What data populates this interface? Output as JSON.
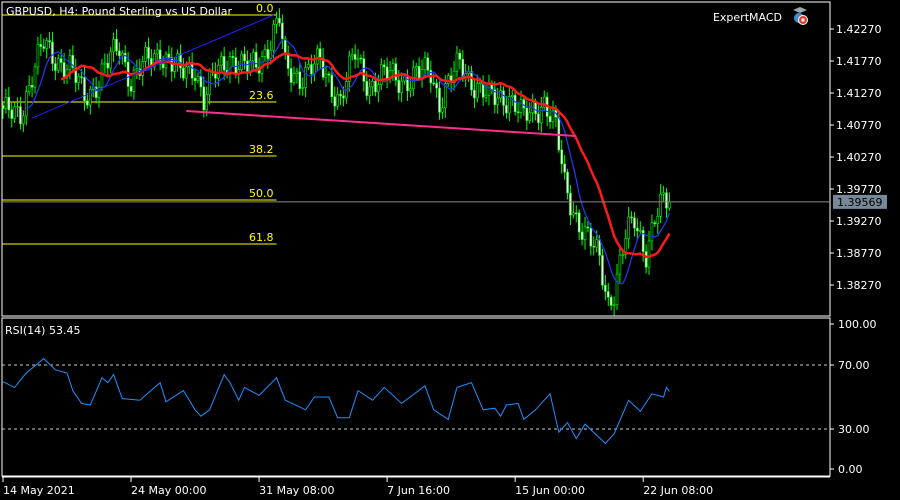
{
  "chart_data": {
    "type": "candlestick",
    "title": "GBPUSD, H4:  Pound Sterling vs US Dollar",
    "expert_label": "ExpertMACD",
    "current_price": 1.39569,
    "current_price_label": "1.39569",
    "y_ticks": [
      "1.42270",
      "1.41770",
      "1.41270",
      "1.40770",
      "1.40270",
      "1.39770",
      "1.39270",
      "1.38770",
      "1.38270"
    ],
    "y_tick_values": [
      1.4227,
      1.4177,
      1.4127,
      1.4077,
      1.4027,
      1.3977,
      1.3927,
      1.3877,
      1.3827
    ],
    "x_ticks": [
      {
        "label": "14 May 2021",
        "bar": 0
      },
      {
        "label": "24 May 00:00",
        "bar": 44
      },
      {
        "label": "31 May 08:00",
        "bar": 88
      },
      {
        "label": "7 Jun 16:00",
        "bar": 132
      },
      {
        "label": "15 Jun 00:00",
        "bar": 176
      },
      {
        "label": "22 Jun 08:00",
        "bar": 220
      }
    ],
    "bar_count": 230,
    "close_path": [
      [
        1,
        1.40926
      ],
      [
        6,
        1.41004
      ],
      [
        14,
        1.4202
      ],
      [
        23,
        1.4163
      ],
      [
        28,
        1.41239
      ],
      [
        33,
        1.41473
      ],
      [
        40,
        1.4202
      ],
      [
        44,
        1.41473
      ],
      [
        54,
        1.41942
      ],
      [
        61,
        1.41551
      ],
      [
        66,
        1.41707
      ],
      [
        69,
        1.41161
      ],
      [
        73,
        1.41551
      ],
      [
        78,
        1.41864
      ],
      [
        83,
        1.4163
      ],
      [
        87,
        1.41707
      ],
      [
        92,
        1.42098
      ],
      [
        95,
        1.42411
      ],
      [
        97,
        1.4163
      ],
      [
        102,
        1.41551
      ],
      [
        109,
        1.41707
      ],
      [
        116,
        1.41161
      ],
      [
        121,
        1.41864
      ],
      [
        126,
        1.41395
      ],
      [
        133,
        1.41551
      ],
      [
        140,
        1.41473
      ],
      [
        147,
        1.4163
      ],
      [
        150,
        1.41161
      ],
      [
        157,
        1.41707
      ],
      [
        160,
        1.41551
      ],
      [
        167,
        1.41161
      ],
      [
        174,
        1.41239
      ],
      [
        179,
        1.40848
      ],
      [
        186,
        1.41161
      ],
      [
        190,
        1.40692
      ],
      [
        193,
        1.39832
      ],
      [
        197,
        1.39364
      ],
      [
        200,
        1.39051
      ],
      [
        205,
        1.38661
      ],
      [
        208,
        1.38036
      ],
      [
        210,
        1.38192
      ],
      [
        214,
        1.38973
      ],
      [
        217,
        1.39286
      ],
      [
        221,
        1.38817
      ],
      [
        224,
        1.39286
      ],
      [
        227,
        1.3952
      ],
      [
        229,
        1.39569
      ]
    ],
    "moving_averages": [
      {
        "name": "fast MA",
        "color": "#1e3cff",
        "period": 8
      },
      {
        "name": "slow MA",
        "color": "#ff1a1a",
        "period": 20
      }
    ],
    "fibonacci": {
      "color": "#ffff00",
      "start_bar": 0,
      "end_bar": 94,
      "levels": [
        {
          "label": "0.0",
          "price": 1.42489
        },
        {
          "label": "23.6",
          "price": 1.41129
        },
        {
          "label": "38.2",
          "price": 1.40286
        },
        {
          "label": "50.0",
          "price": 1.39598
        },
        {
          "label": "61.8",
          "price": 1.38911
        }
      ]
    },
    "trendlines": [
      {
        "name": "blue trendline",
        "color": "#2020ff",
        "from": [
          10,
          1.40879
        ],
        "to": [
          93,
          1.42489
        ]
      },
      {
        "name": "pink trendline",
        "color": "#ff2d8c",
        "from": [
          63,
          1.40989
        ],
        "to": [
          197,
          1.40598
        ]
      }
    ],
    "rsi": {
      "label": "RSI(14) 53.45",
      "color": "#1e90ff",
      "levels": [
        70,
        30
      ],
      "y_ticks": [
        "100.00",
        "70.00",
        "30.00",
        "0.00"
      ],
      "y_tick_values": [
        100,
        70,
        30,
        0
      ],
      "points": [
        [
          0,
          59.6
        ],
        [
          4,
          56
        ],
        [
          6,
          60.6
        ],
        [
          8,
          65
        ],
        [
          14,
          74
        ],
        [
          18,
          67
        ],
        [
          22,
          65
        ],
        [
          24,
          54
        ],
        [
          27,
          46
        ],
        [
          30,
          45
        ],
        [
          34,
          62
        ],
        [
          36,
          59
        ],
        [
          38,
          64
        ],
        [
          41,
          49
        ],
        [
          47,
          48
        ],
        [
          54,
          59
        ],
        [
          56,
          47
        ],
        [
          62,
          54
        ],
        [
          66,
          42
        ],
        [
          68,
          38
        ],
        [
          71,
          42
        ],
        [
          76,
          64
        ],
        [
          78,
          59
        ],
        [
          81,
          48
        ],
        [
          83,
          56
        ],
        [
          88,
          51
        ],
        [
          94,
          62
        ],
        [
          97,
          48
        ],
        [
          104,
          42
        ],
        [
          107,
          50
        ],
        [
          112,
          50
        ],
        [
          115,
          37
        ],
        [
          119,
          37
        ],
        [
          122,
          54
        ],
        [
          127,
          48
        ],
        [
          131,
          56
        ],
        [
          137,
          46
        ],
        [
          145,
          57
        ],
        [
          148,
          42
        ],
        [
          153,
          36
        ],
        [
          156,
          56
        ],
        [
          161,
          59
        ],
        [
          165,
          42
        ],
        [
          169,
          43
        ],
        [
          171,
          38
        ],
        [
          173,
          45
        ],
        [
          177,
          46
        ],
        [
          179,
          36
        ],
        [
          183,
          42
        ],
        [
          188,
          52
        ],
        [
          191,
          28
        ],
        [
          194,
          34
        ],
        [
          197,
          24
        ],
        [
          200,
          33
        ],
        [
          207,
          21
        ],
        [
          210,
          27
        ],
        [
          215,
          48
        ],
        [
          219,
          41
        ],
        [
          223,
          52
        ],
        [
          227,
          50
        ],
        [
          228,
          56
        ],
        [
          229,
          53.45
        ]
      ]
    }
  }
}
